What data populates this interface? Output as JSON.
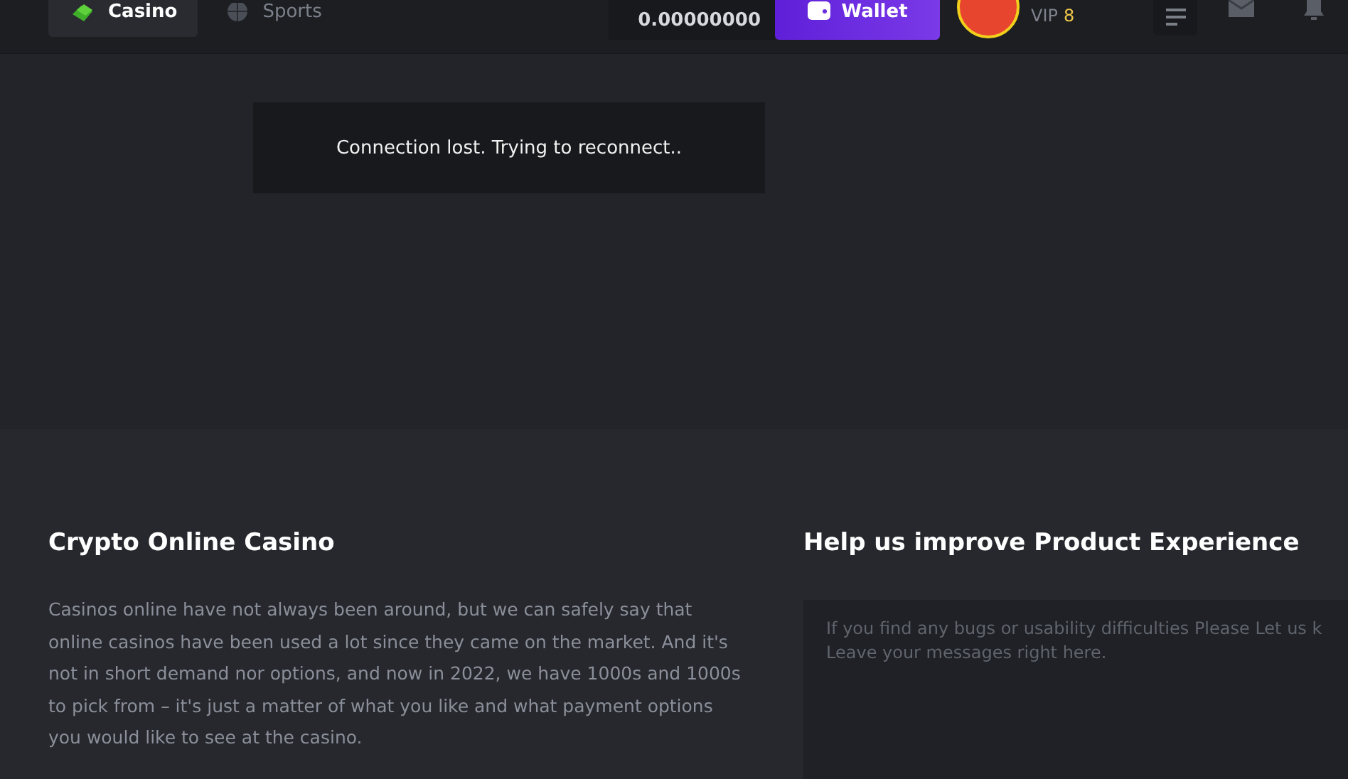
{
  "nav_tabs": [
    {
      "label": "Casino",
      "selected": true,
      "kind": "casino"
    },
    {
      "label": "Sports",
      "selected": false,
      "kind": "sports"
    }
  ],
  "balance": {
    "amount": "0.00000000"
  },
  "wallet_button": {
    "label": "Wallet"
  },
  "user": {
    "vip_label": "VIP",
    "vip_level": "8"
  },
  "toast": {
    "message": "Connection lost. Trying to reconnect.."
  },
  "footer": {
    "about": {
      "title": "Crypto Online Casino",
      "text": "Casinos online have not always been around, but we can safely say that online casinos have been used a lot since they came on the market. And it's not in short demand nor options, and now in 2022, we have 1000s and 1000s to pick from – it's just a matter of what you like and what payment options you would like to see at the casino."
    },
    "feedback": {
      "title": "Help us improve Product Experience",
      "placeholder": "If you find any bugs or usability difficulties Please Let us k\nLeave your messages right here."
    }
  }
}
